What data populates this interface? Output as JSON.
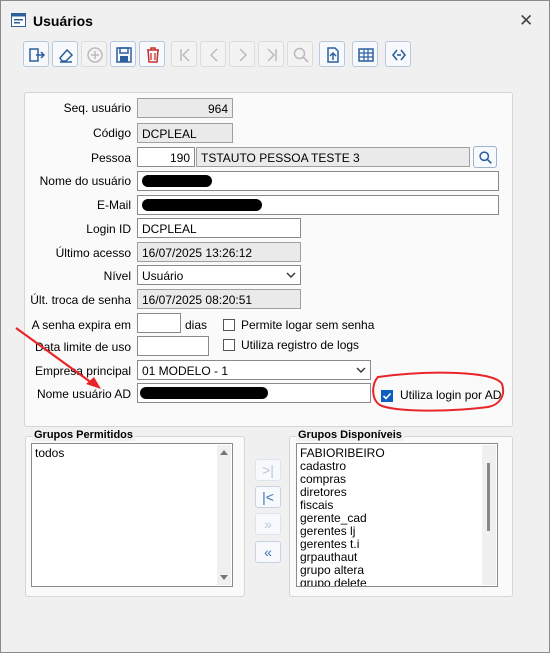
{
  "window": {
    "title": "Usuários",
    "close_glyph": "✕"
  },
  "toolbar": [
    "exit-icon",
    "eraser-icon",
    "add-icon",
    "save-icon",
    "delete-icon",
    "first-icon",
    "prev-icon",
    "next-icon",
    "last-icon",
    "search-icon",
    "export-icon",
    "table-icon",
    "sync-icon"
  ],
  "form": {
    "seq_label": "Seq. usuário",
    "seq_value": "964",
    "codigo_label": "Código",
    "codigo_value": "DCPLEAL",
    "pessoa_label": "Pessoa",
    "pessoa_code": "190",
    "pessoa_name": "TSTAUTO PESSOA TESTE 3",
    "nome_label": "Nome do usuário",
    "email_label": "E-Mail",
    "login_label": "Login ID",
    "login_value": "DCPLEAL",
    "ultimo_label": "Último acesso",
    "ultimo_value": "16/07/2025 13:26:12",
    "nivel_label": "Nível",
    "nivel_value": "Usuário",
    "troca_label": "Últ. troca de senha",
    "troca_value": "16/07/2025 08:20:51",
    "expira_label": "A senha expira em",
    "expira_value": "",
    "expira_unit": "dias",
    "permite_label": "Permite logar sem senha",
    "limite_label": "Data limite de uso",
    "limite_value": "",
    "registro_label": "Utiliza registro de logs",
    "empresa_label": "Empresa principal",
    "empresa_value": "01 MODELO - 1",
    "ad_label": "Nome usuário AD",
    "ad_login_label": "Utiliza login por AD",
    "ad_login_checked": true
  },
  "permitidos": {
    "title": "Grupos Permitidos",
    "items": [
      "todos"
    ]
  },
  "disponiveis": {
    "title": "Grupos Disponíveis",
    "items": [
      "FABIORIBEIRO",
      "cadastro",
      "compras",
      "diretores",
      "fiscais",
      "gerente_cad",
      "gerentes lj",
      "gerentes t.i",
      "grpauthaut",
      "grupo altera",
      "grupo delete"
    ]
  },
  "move_buttons": [
    ">|",
    "|<",
    "»",
    "«"
  ],
  "colors": {
    "accent": "#0a5fbf",
    "annotation": "#e8262a"
  }
}
